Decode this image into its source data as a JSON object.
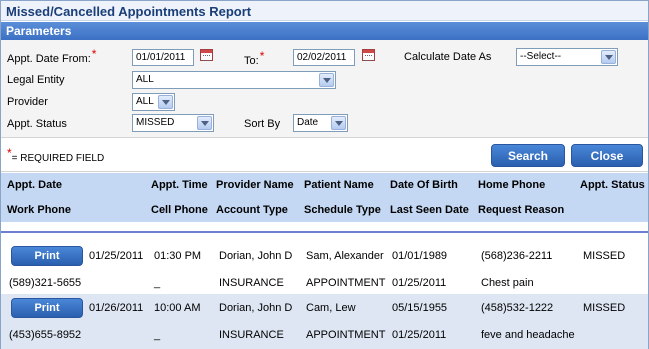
{
  "report": {
    "title": "Missed/Cancelled Appointments Report"
  },
  "params": {
    "section_label": "Parameters",
    "date_from_label": "Appt. Date From:",
    "date_from_value": "01/01/2011",
    "to_label": "To:",
    "to_value": "02/02/2011",
    "calc_label": "Calculate Date As",
    "calc_value": "--Select--",
    "legal_entity_label": "Legal Entity",
    "legal_entity_value": "ALL",
    "provider_label": "Provider",
    "provider_value": "ALL",
    "status_label": "Appt. Status",
    "status_value": "MISSED",
    "sort_label": "Sort By",
    "sort_value": "Date",
    "required_marker": "*",
    "required_note": "= REQUIRED FIELD"
  },
  "actions": {
    "search_label": "Search",
    "close_label": "Close"
  },
  "grid": {
    "header_row1": [
      "Appt. Date",
      "Appt. Time",
      "Provider Name",
      "Patient Name",
      "Date Of Birth",
      "Home Phone",
      "Appt. Status"
    ],
    "header_row2": [
      "Work Phone",
      "Cell Phone",
      "Account Type",
      "Schedule Type",
      "Last Seen Date",
      "Request Reason"
    ],
    "rows": [
      {
        "print_label": "Print",
        "appt_date": "01/25/2011",
        "appt_time": "01:30 PM",
        "provider": "Dorian, John D",
        "patient": "Sam, Alexander",
        "dob": "01/01/1989",
        "home_phone": "(568)236-2211",
        "status": "MISSED",
        "work_phone": "(589)321-5655",
        "cell_phone": "_",
        "account_type": "INSURANCE",
        "schedule_type": "APPOINTMENT",
        "last_seen": "01/25/2011",
        "reason": "Chest pain"
      },
      {
        "print_label": "Print",
        "appt_date": "01/26/2011",
        "appt_time": "10:00 AM",
        "provider": "Dorian, John D",
        "patient": "Cam, Lew",
        "dob": "05/15/1955",
        "home_phone": "(458)532-1222",
        "status": "MISSED",
        "work_phone": "(453)655-8952",
        "cell_phone": "_",
        "account_type": "INSURANCE",
        "schedule_type": "APPOINTMENT",
        "last_seen": "01/25/2011",
        "reason": "feve and headache"
      }
    ]
  },
  "colors": {
    "section_bar": "#3c70c4",
    "grid_header": "#c4d8f4",
    "alt_row": "#dde6f2",
    "required": "#e00000",
    "title_text": "#1a3e78"
  }
}
